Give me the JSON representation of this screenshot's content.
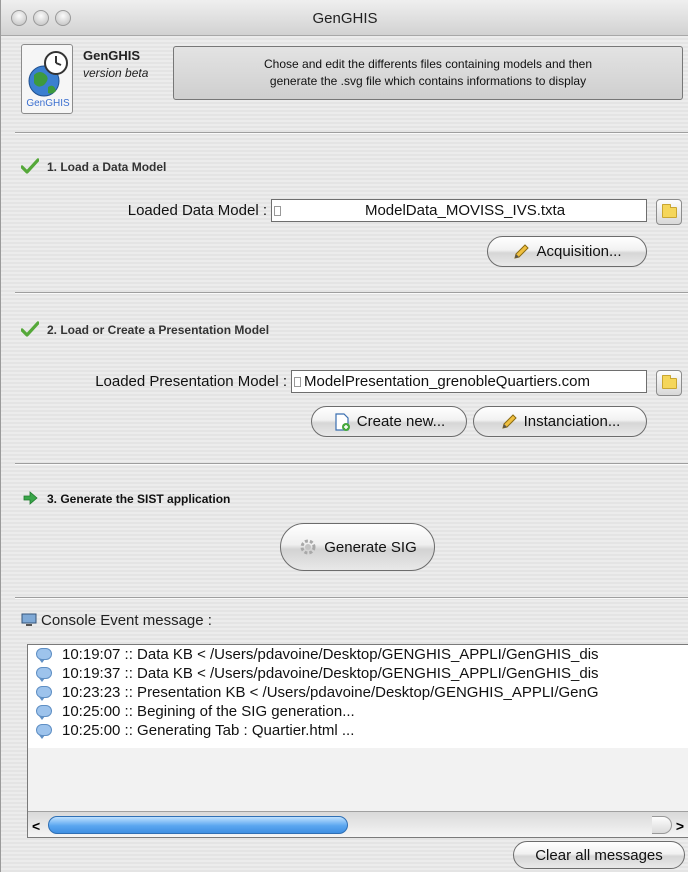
{
  "window": {
    "title": "GenGHIS"
  },
  "header": {
    "app_name": "GenGHIS",
    "app_version": "version beta",
    "icon_label": "GenGHIS",
    "description_line1": "Chose and edit the differents files containing models and then",
    "description_line2": "generate the .svg file  which contains informations to display"
  },
  "step1": {
    "title": "1. Load a Data Model",
    "status_icon": "checkmark-icon",
    "field_label": "Loaded Data Model :",
    "field_value": "ModelData_MOVISS_IVS.txta",
    "acquisition_label": "Acquisition..."
  },
  "step2": {
    "title": "2. Load or Create a Presentation Model",
    "status_icon": "checkmark-icon",
    "field_label": "Loaded Presentation Model :",
    "field_value": "ModelPresentation_grenobleQuartiers.com",
    "create_label": "Create new...",
    "instanciation_label": "Instanciation..."
  },
  "step3": {
    "title": "3. Generate the SIST application",
    "status_icon": "arrow-right-icon",
    "generate_label": "Generate SIG"
  },
  "console": {
    "title": "Console Event message :",
    "messages": [
      "10:19:07 :: Data KB < /Users/pdavoine/Desktop/GENGHIS_APPLI/GenGHIS_dis",
      "10:19:37 :: Data KB < /Users/pdavoine/Desktop/GENGHIS_APPLI/GenGHIS_dis",
      "10:23:23 :: Presentation KB < /Users/pdavoine/Desktop/GENGHIS_APPLI/GenG",
      "10:25:00 :: Begining of the SIG generation...",
      "10:25:00 :: Generating Tab : Quartier.html ..."
    ],
    "clear_label": "Clear all messages",
    "scroll_left": "<",
    "scroll_right": ">"
  },
  "colors": {
    "check_green": "#55a839",
    "arrow_green": "#3aa64a",
    "scroll_blue": "#3f8fe2"
  }
}
